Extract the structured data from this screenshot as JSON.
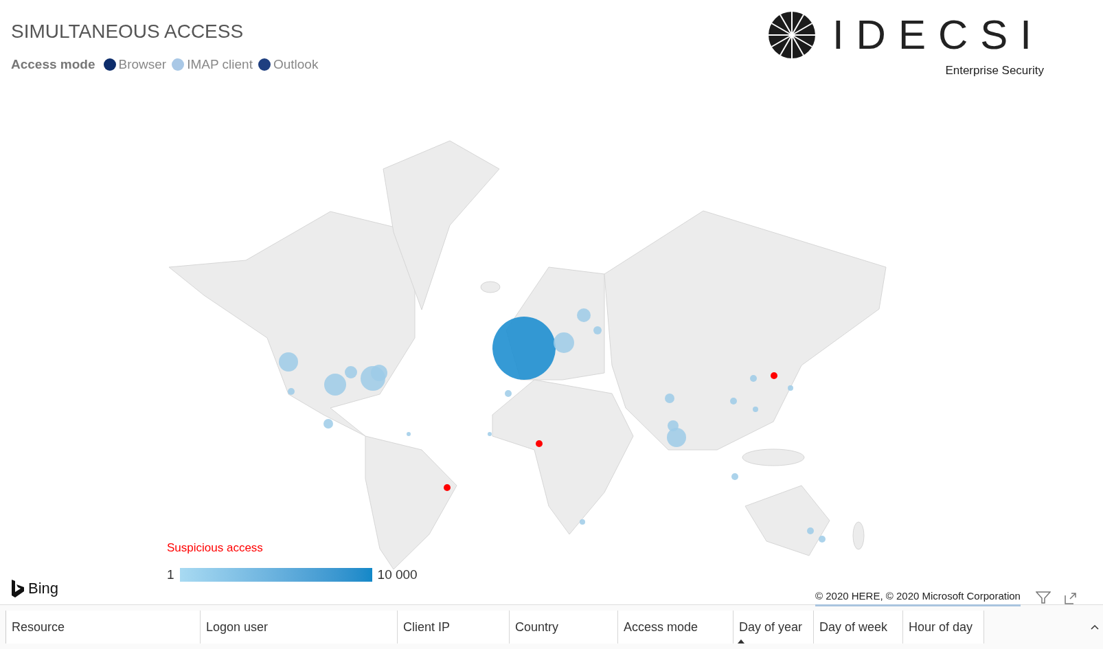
{
  "title": "SIMULTANEOUS ACCESS",
  "legend": {
    "label": "Access mode",
    "items": [
      {
        "label": "Browser",
        "color": "#0d2d6b"
      },
      {
        "label": "IMAP client",
        "color": "#a9c8e6"
      },
      {
        "label": "Outlook",
        "color": "#1f3f80"
      }
    ]
  },
  "logo": {
    "name": "IDECSI",
    "tagline": "Enterprise Security"
  },
  "map": {
    "scale_title": "Suspicious access",
    "scale_min": "1",
    "scale_max": "10 000",
    "provider": "Bing",
    "copyright": "© 2020 HERE, © 2020 Microsoft Corporation"
  },
  "table": {
    "columns": [
      {
        "label": "Resource",
        "sorted": false
      },
      {
        "label": "Logon user",
        "sorted": false
      },
      {
        "label": "Client IP",
        "sorted": false
      },
      {
        "label": "Country",
        "sorted": false
      },
      {
        "label": "Access mode",
        "sorted": false
      },
      {
        "label": "Day of year",
        "sorted": true
      },
      {
        "label": "Day of week",
        "sorted": false
      },
      {
        "label": "Hour of day",
        "sorted": false
      }
    ]
  }
}
